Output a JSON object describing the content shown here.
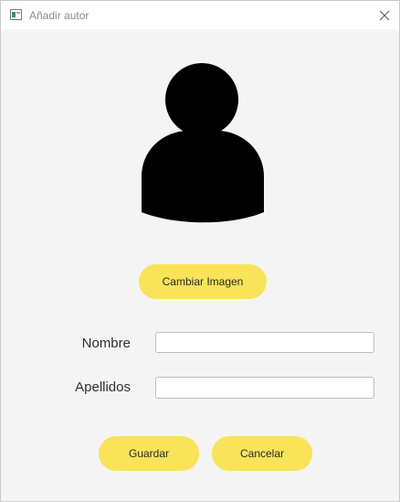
{
  "window": {
    "title": "Añadir autor",
    "icon": "window-app-icon",
    "close_icon": "close-icon"
  },
  "avatar": {
    "icon": "user-silhouette-icon"
  },
  "buttons": {
    "change_image": "Cambiar Imagen",
    "save": "Guardar",
    "cancel": "Cancelar"
  },
  "form": {
    "nombre_label": "Nombre",
    "nombre_value": "",
    "apellidos_label": "Apellidos",
    "apellidos_value": ""
  },
  "colors": {
    "button_bg": "#f8e359",
    "window_bg": "#f4f4f4",
    "titlebar_bg": "#ffffff"
  }
}
